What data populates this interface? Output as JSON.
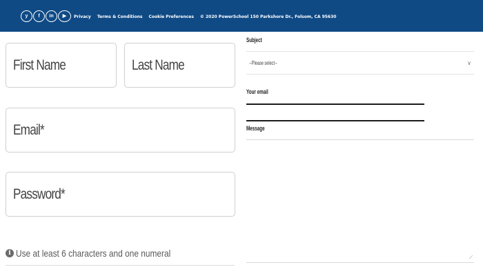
{
  "footer": {
    "social": [
      {
        "name": "twitter",
        "glyph": "y"
      },
      {
        "name": "facebook",
        "glyph": "f"
      },
      {
        "name": "linkedin",
        "glyph": "in"
      },
      {
        "name": "youtube",
        "glyph": "▶"
      }
    ],
    "links": [
      "Privacy",
      "Terms & Conditions",
      "Cookie Preferences"
    ],
    "copyright": "© 2020 PowerSchool 150 Parkshore Dr., Folsom, CA 95630",
    "bg_color": "#0f4a85"
  },
  "signup": {
    "first_name_placeholder": "First Name",
    "last_name_placeholder": "Last Name",
    "email_placeholder": "Email*",
    "password_placeholder": "Password*",
    "password_hint": "Use at least 6 characters and one numeral"
  },
  "contact": {
    "subject_label": "Subject",
    "subject_value": "--Please select--",
    "email_label": "Your email",
    "message_label": "Message"
  }
}
